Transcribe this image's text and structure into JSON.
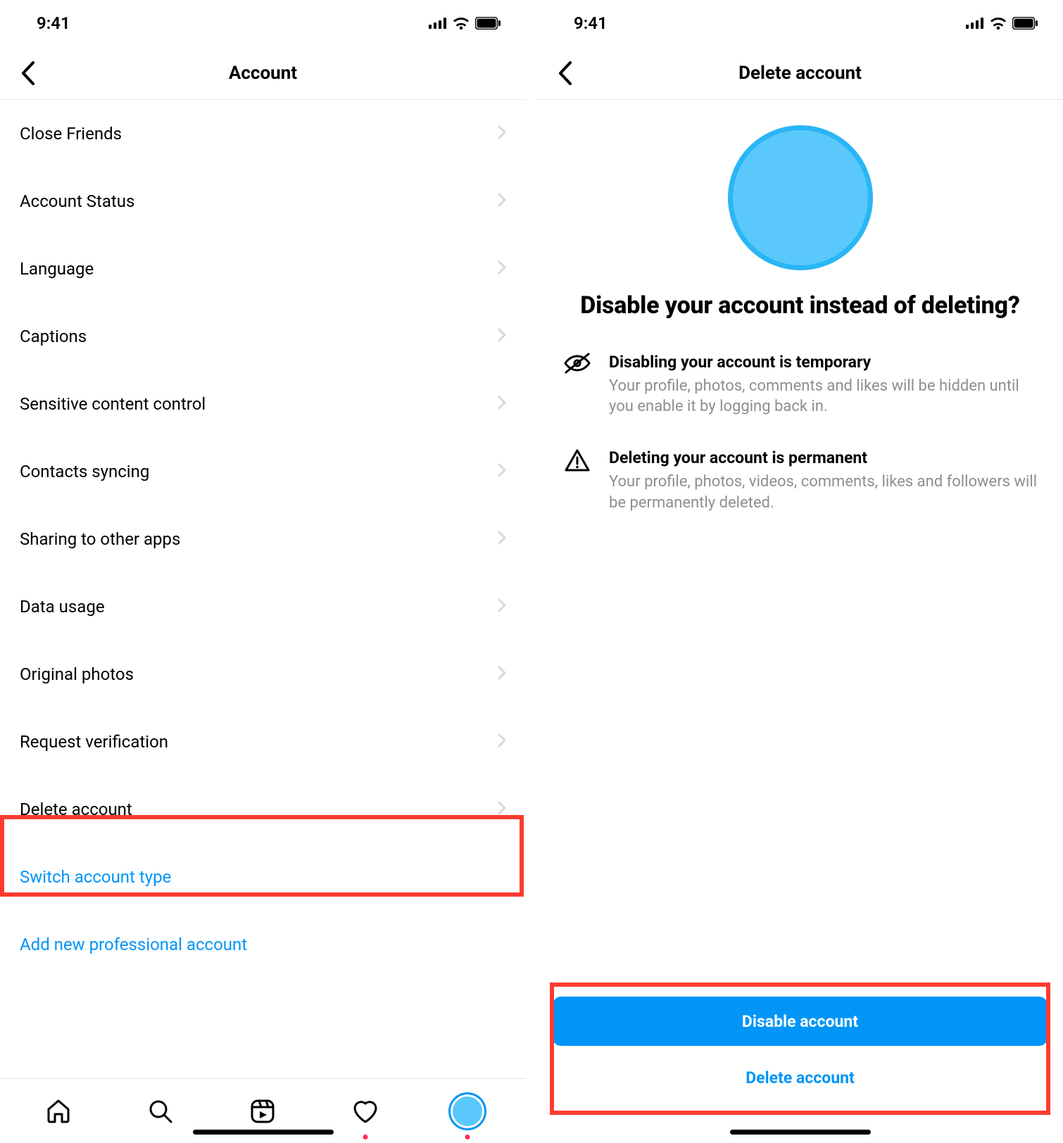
{
  "status": {
    "time": "9:41"
  },
  "left": {
    "title": "Account",
    "rows": [
      {
        "label": "Close Friends"
      },
      {
        "label": "Account Status"
      },
      {
        "label": "Language"
      },
      {
        "label": "Captions"
      },
      {
        "label": "Sensitive content control"
      },
      {
        "label": "Contacts syncing"
      },
      {
        "label": "Sharing to other apps"
      },
      {
        "label": "Data usage"
      },
      {
        "label": "Original photos"
      },
      {
        "label": "Request verification"
      },
      {
        "label": "Delete account"
      }
    ],
    "link1": "Switch account type",
    "link2": "Add new professional account",
    "highlight_index": 10
  },
  "right": {
    "title": "Delete account",
    "headline": "Disable your account instead of deleting?",
    "item1_title": "Disabling your account is temporary",
    "item1_desc": "Your profile, photos, comments and likes will be hidden until you enable it by logging back in.",
    "item2_title": "Deleting your account is permanent",
    "item2_desc": "Your profile, photos, videos, comments, likes and followers will be permanently deleted.",
    "primary_btn": "Disable account",
    "secondary_btn": "Delete account"
  },
  "colors": {
    "accent": "#0095f6",
    "highlight": "#ff3b30",
    "avatar": "#5ac8fa"
  }
}
